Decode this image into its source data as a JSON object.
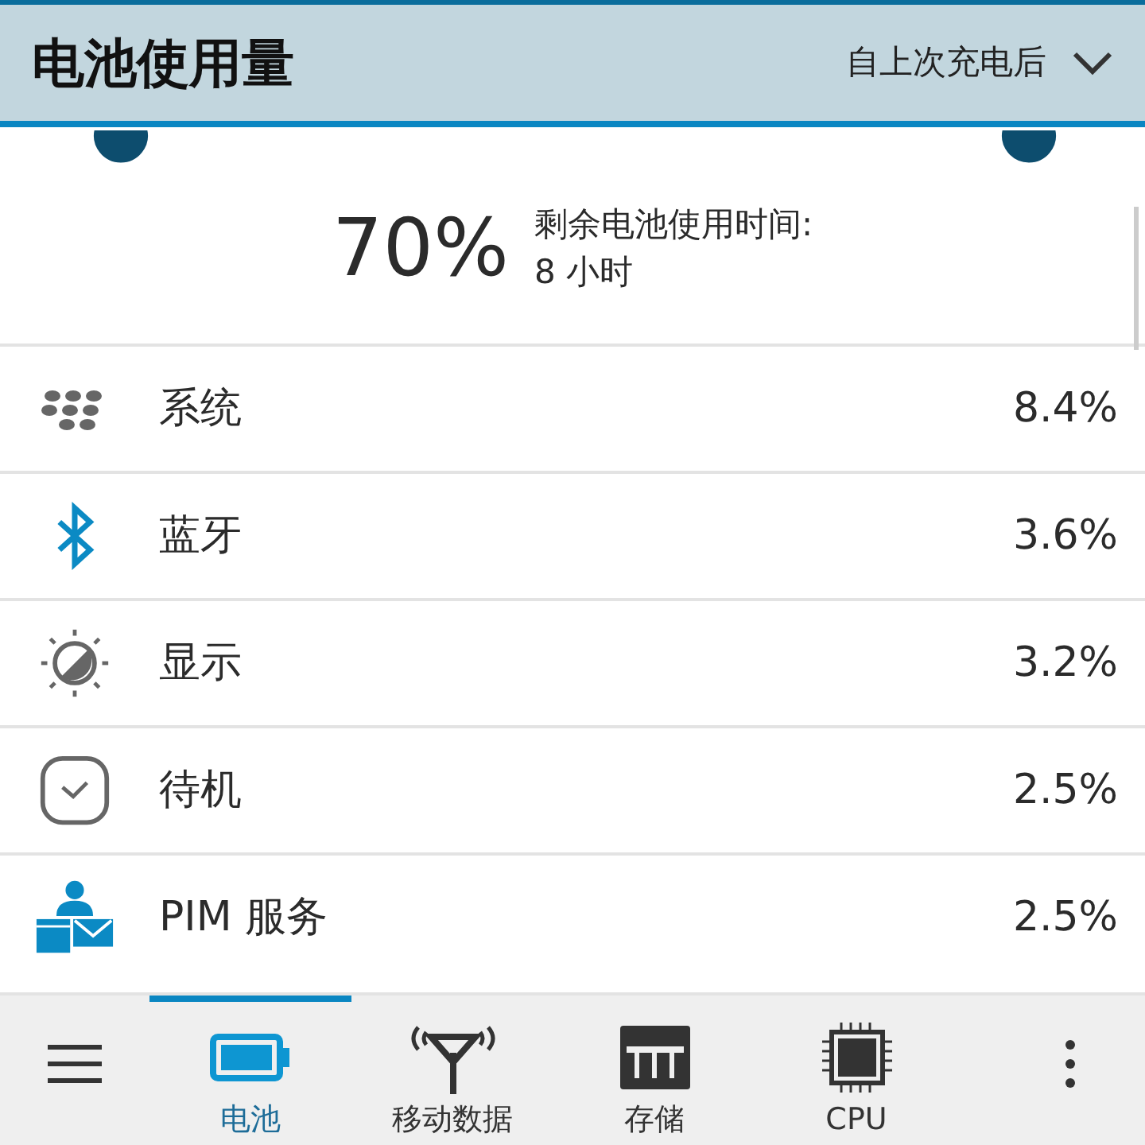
{
  "header": {
    "title": "电池使用量",
    "period": "自上次充电后"
  },
  "summary": {
    "percent": "70%",
    "label": "剩余电池使用时间:",
    "remaining": "8 小时"
  },
  "apps": [
    {
      "name": "系统",
      "usage": "8.4%"
    },
    {
      "name": "蓝牙",
      "usage": "3.6%"
    },
    {
      "name": "显示",
      "usage": "3.2%"
    },
    {
      "name": "待机",
      "usage": "2.5%"
    },
    {
      "name": "PIM 服务",
      "usage": "2.5%"
    }
  ],
  "tabs": [
    {
      "label": "电池",
      "selected": true
    },
    {
      "label": "移动数据",
      "selected": false
    },
    {
      "label": "存储",
      "selected": false
    },
    {
      "label": "CPU",
      "selected": false
    }
  ]
}
